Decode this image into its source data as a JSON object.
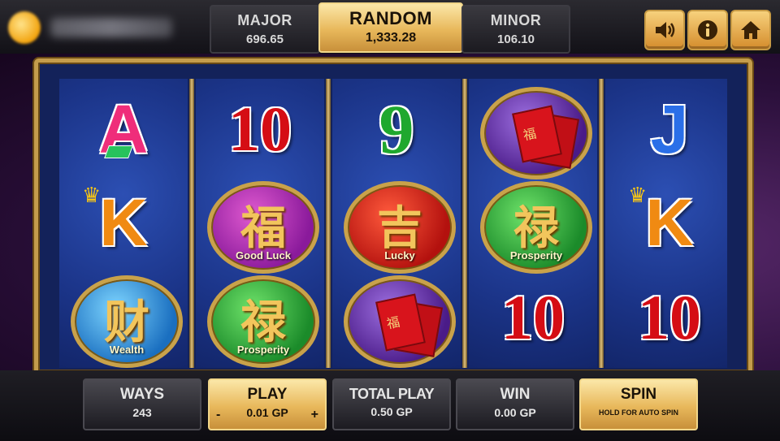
{
  "jackpots": {
    "major": {
      "label": "MAJOR",
      "value": "696.65"
    },
    "random": {
      "label": "RANDOM",
      "value": "1,333.28"
    },
    "minor": {
      "label": "MINOR",
      "value": "106.10"
    }
  },
  "top_buttons": [
    "speaker-icon",
    "info-icon",
    "home-icon"
  ],
  "reels": [
    [
      "A",
      "K",
      "Wealth"
    ],
    [
      "10",
      "Good Luck",
      "Prosperity"
    ],
    [
      "9",
      "Lucky",
      "red-envelope"
    ],
    [
      "red-envelope",
      "Prosperity",
      "10"
    ],
    [
      "J",
      "K",
      "10"
    ]
  ],
  "symbols": {
    "good_luck": {
      "char": "福",
      "caption": "Good Luck"
    },
    "lucky": {
      "char": "吉",
      "caption": "Lucky"
    },
    "prosperity": {
      "char": "禄",
      "caption": "Prosperity"
    },
    "wealth": {
      "char": "财",
      "caption": "Wealth"
    },
    "envelope_char": "福"
  },
  "panel": {
    "ways": {
      "label": "WAYS",
      "value": "243"
    },
    "play": {
      "label": "PLAY",
      "value": "0.01 GP",
      "minus": "-",
      "plus": "+"
    },
    "total_play": {
      "label": "TOTAL PLAY",
      "value": "0.50 GP"
    },
    "win": {
      "label": "WIN",
      "value": "0.00 GP"
    },
    "spin": {
      "label": "SPIN",
      "sub": "HOLD FOR AUTO SPIN"
    }
  }
}
